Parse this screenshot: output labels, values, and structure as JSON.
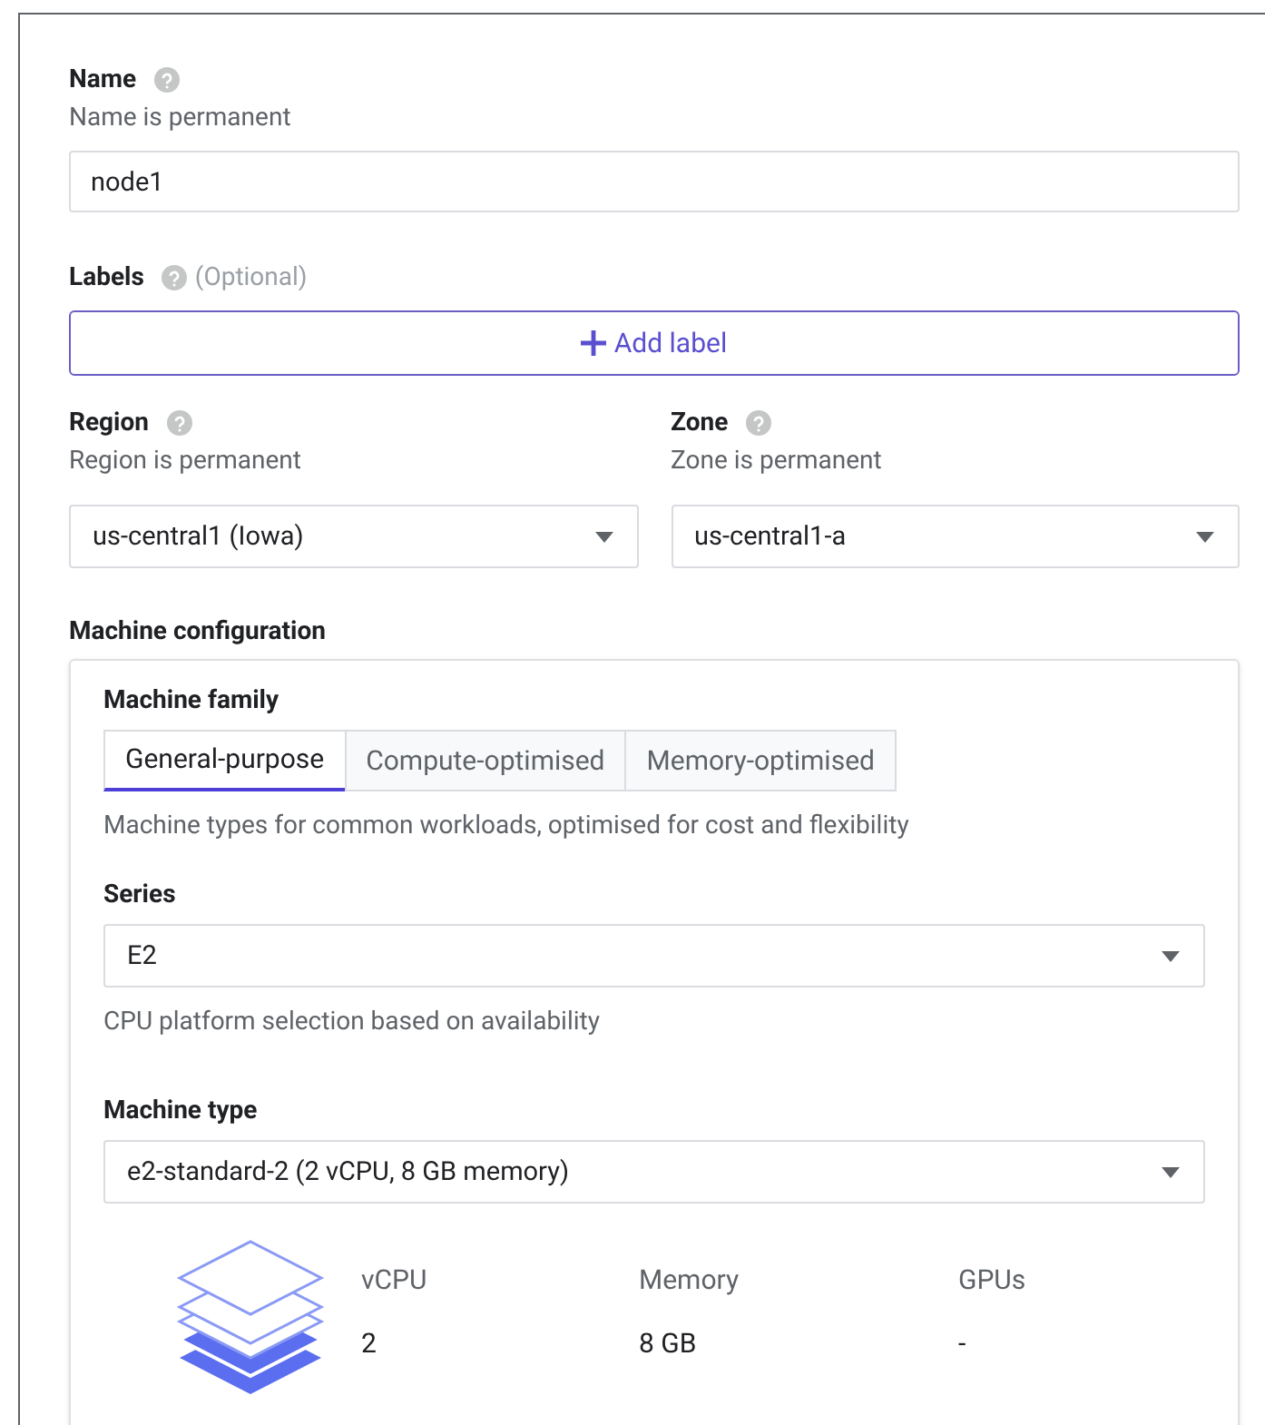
{
  "name": {
    "label": "Name",
    "hint": "Name is permanent",
    "value": "node1"
  },
  "labels": {
    "label": "Labels",
    "optional": "(Optional)",
    "button": "Add label"
  },
  "region": {
    "label": "Region",
    "hint": "Region is permanent",
    "value": "us-central1 (Iowa)"
  },
  "zone": {
    "label": "Zone",
    "hint": "Zone is permanent",
    "value": "us-central1-a"
  },
  "machine_configuration": {
    "title": "Machine configuration",
    "family_label": "Machine family",
    "tabs": [
      {
        "label": "General-purpose",
        "selected": true
      },
      {
        "label": "Compute-optimised",
        "selected": false
      },
      {
        "label": "Memory-optimised",
        "selected": false
      }
    ],
    "family_description": "Machine types for common workloads, optimised for cost and flexibility",
    "series": {
      "label": "Series",
      "value": "E2",
      "hint": "CPU platform selection based on availability"
    },
    "machine_type": {
      "label": "Machine type",
      "value": "e2-standard-2 (2 vCPU, 8 GB memory)"
    },
    "specs": [
      {
        "label": "vCPU",
        "value": "2"
      },
      {
        "label": "Memory",
        "value": "8 GB"
      },
      {
        "label": "GPUs",
        "value": "-"
      }
    ]
  }
}
